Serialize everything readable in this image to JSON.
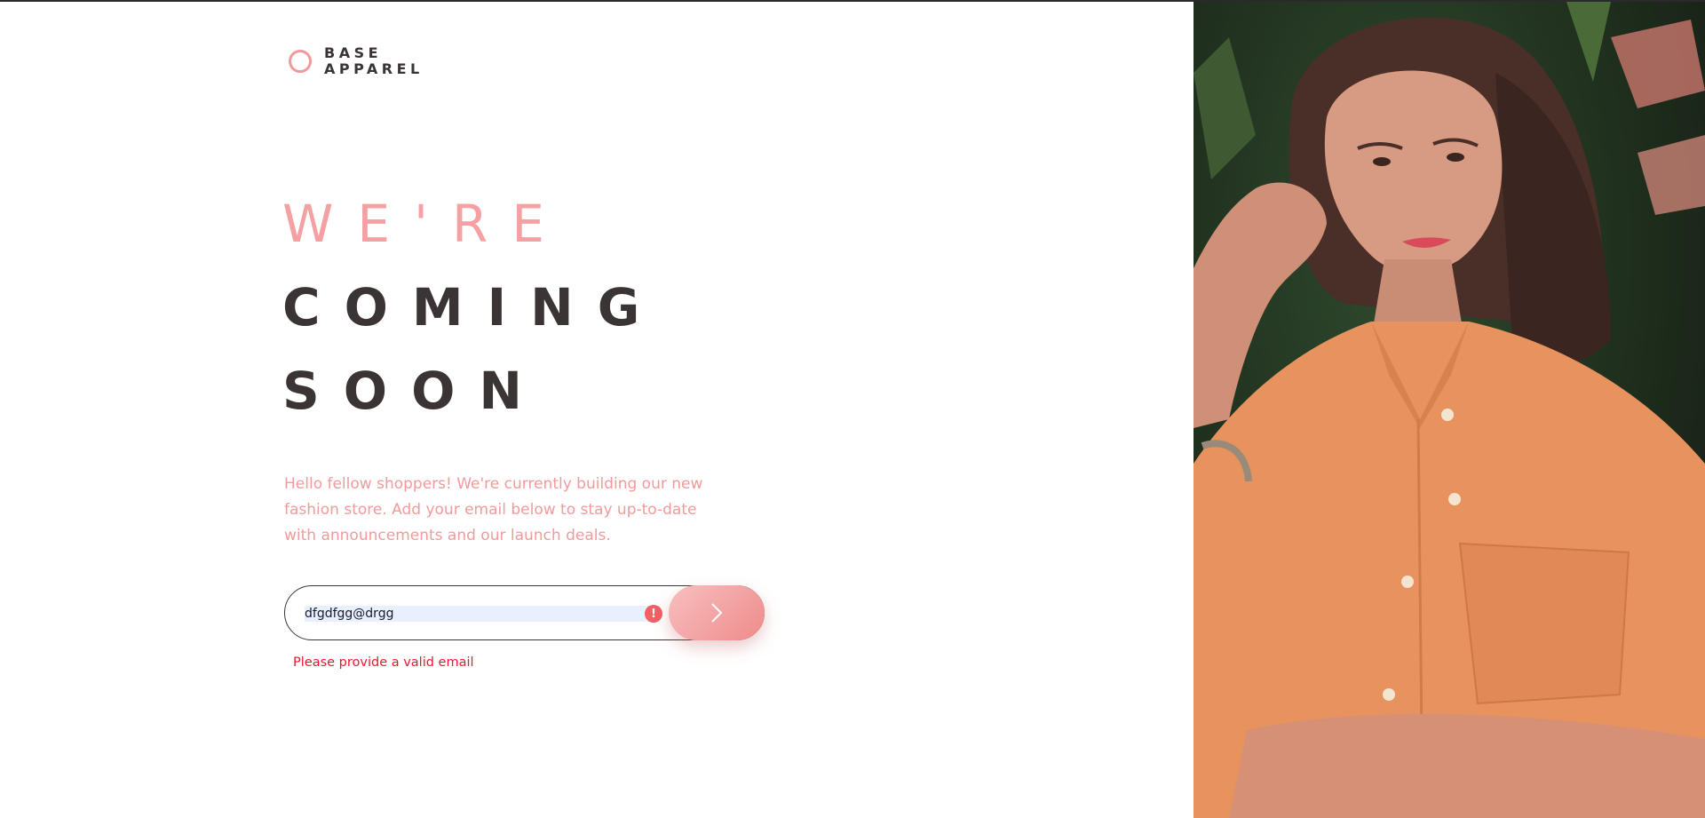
{
  "brand": {
    "line1": "BASE",
    "line2": "APPAREL",
    "accent_color": "#f5989b",
    "dark_color": "#3b3434"
  },
  "hero": {
    "line1": "We're",
    "line2": "coming",
    "line3": "soon",
    "description": "Hello fellow shoppers! We're currently building our new fashion store. Add your email below to stay up-to-date with announcements and our launch deals."
  },
  "form": {
    "email_value": "dfgdfgg@drgg",
    "error_icon": "!",
    "submit_icon": "arrow-right-icon",
    "error_message": "Please provide a valid email",
    "error_color": "#f0142f"
  },
  "image": {
    "subject": "hero-photo"
  }
}
